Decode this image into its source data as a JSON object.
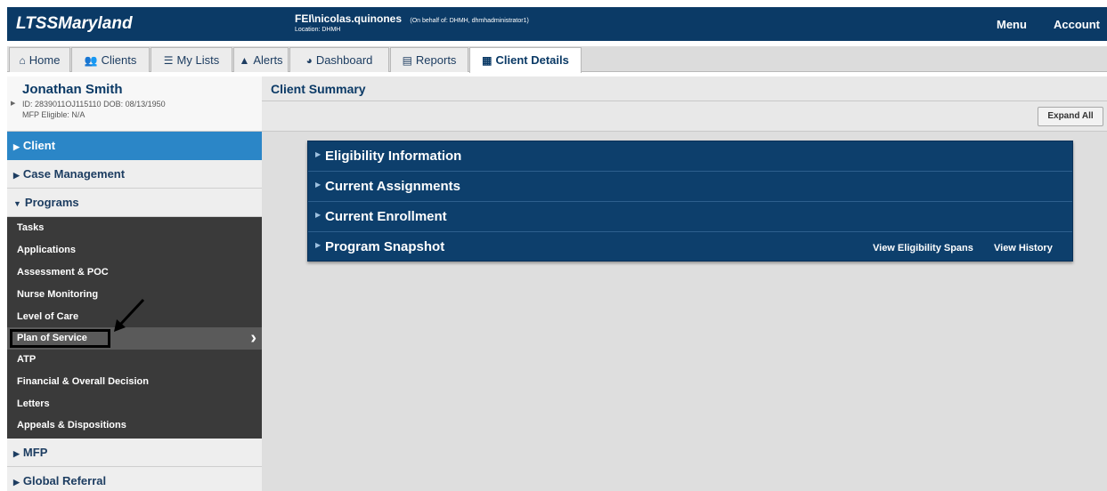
{
  "header": {
    "brand": "LTSSMaryland",
    "user": "FEI\\nicolas.quinones",
    "on_behalf": "(On behalf of: DHMH, dhmhadministrator1)",
    "location": "Location: DHMH",
    "menu_label": "Menu",
    "account_label": "Account"
  },
  "tabs": [
    {
      "label": "Home",
      "icon": "home-icon"
    },
    {
      "label": "Clients",
      "icon": "people-icon"
    },
    {
      "label": "My Lists",
      "icon": "list-icon"
    },
    {
      "label": "Alerts",
      "icon": "warning-icon"
    },
    {
      "label": "Dashboard",
      "icon": "dashboard-icon"
    },
    {
      "label": "Reports",
      "icon": "report-icon"
    },
    {
      "label": "Client Details",
      "icon": "client-details-icon",
      "active": true
    }
  ],
  "client": {
    "name": "Jonathan Smith",
    "id_line": "ID: 2839011OJ115110 DOB: 08/13/1950",
    "mfp": "MFP Eligible: N/A"
  },
  "summary": {
    "title": "Client Summary",
    "expand_all": "Expand All"
  },
  "sidebar": {
    "sections": [
      "Client",
      "Case Management",
      "Programs",
      "MFP",
      "Global Referral"
    ],
    "programs": [
      "Tasks",
      "Applications",
      "Assessment & POC",
      "Nurse Monitoring",
      "Level of Care",
      "Plan of Service",
      "ATP",
      "Financial & Overall Decision",
      "Letters",
      "Appeals & Dispositions"
    ],
    "selected": "Plan of Service"
  },
  "panel": {
    "rows": [
      "Eligibility Information",
      "Current Assignments",
      "Current Enrollment",
      "Program Snapshot"
    ],
    "view_spans": "View Eligibility Spans",
    "view_history": "View History"
  },
  "colors": {
    "brand_blue": "#0b3a66",
    "active_blue": "#2b86c7",
    "panel_blue": "#0d3f6c",
    "program_bg": "#3a3a3a"
  }
}
